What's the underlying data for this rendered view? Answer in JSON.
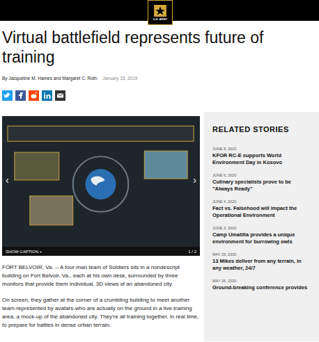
{
  "header": {
    "logo": "U.S. ARMY"
  },
  "article": {
    "title": "Virtual battlefield represents future of training",
    "byline": "By Jacqueline M. Hames and Margaret C. Roth",
    "date": "January 15, 2019",
    "share": [
      {
        "kind": "twitter"
      },
      {
        "kind": "facebook"
      },
      {
        "kind": "reddit"
      },
      {
        "kind": "linkedin"
      },
      {
        "kind": "email"
      }
    ],
    "gallery": {
      "prev": "‹",
      "next": "›",
      "caption_toggle": "SHOW CAPTION +",
      "counter": "1 / 2"
    },
    "paragraphs": [
      "FORT BELVOIR, Va. -- A four-man team of Soldiers sits in a nondescript building on Fort Belvoir, Va., each at his own desk, surrounded by three monitors that provide them individual, 3D views of an abandoned city.",
      "On screen, they gather at the corner of a crumbling building to meet another team-represented by avatars-who are actually on the ground in a live-training area, a mock-up of the abandoned city. They're all training together, in real time, to prepare for battles in dense urban terrain."
    ]
  },
  "related": {
    "heading": "RELATED STORIES",
    "items": [
      {
        "date": "JUNE 8, 2020",
        "title": "KFOR RC-E supports World Environment Day in Kosovo"
      },
      {
        "date": "JUNE 6, 2020",
        "title": "Culinary specialists prove to be \"Always Ready\""
      },
      {
        "date": "JUNE 4, 2020",
        "title": "Fact vs. Falsehood will impact the Operational Environment"
      },
      {
        "date": "JUNE 3, 2020",
        "title": "Camp Umatilla provides a unique environment for burrowing owls"
      },
      {
        "date": "MAY 29, 2020",
        "title": "13 Mikes deliver from any terrain, in any weather, 24/7"
      },
      {
        "date": "MAY 26, 2020",
        "title": "Ground-breaking conference provides"
      }
    ]
  }
}
